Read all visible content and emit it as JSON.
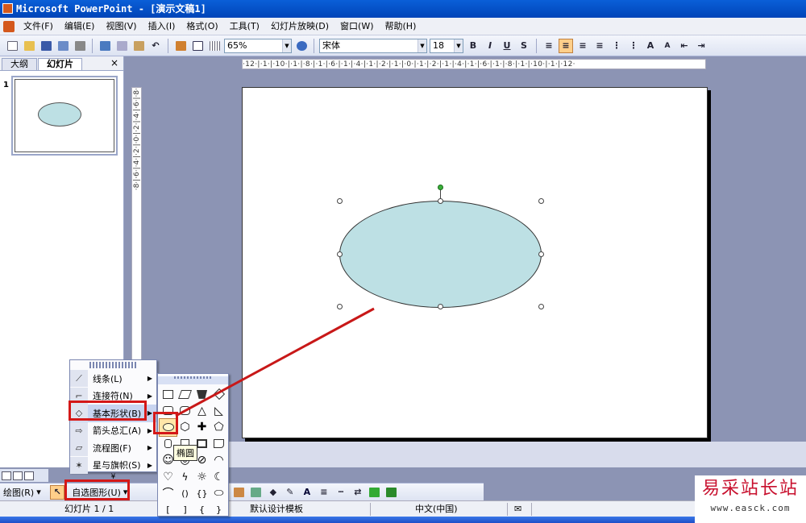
{
  "title": "Microsoft PowerPoint - [演示文稿1]",
  "menu": [
    "文件(F)",
    "编辑(E)",
    "视图(V)",
    "插入(I)",
    "格式(O)",
    "工具(T)",
    "幻灯片放映(D)",
    "窗口(W)",
    "帮助(H)"
  ],
  "toolbar": {
    "zoom": "65%",
    "font": "宋体",
    "size": "18",
    "bold": "B",
    "italic": "I",
    "underline": "U",
    "shadow": "S",
    "font_grow": "A",
    "font_shrink": "A"
  },
  "left_pane": {
    "tabs": [
      "大纲",
      "幻灯片"
    ],
    "close": "×",
    "slide_number": "1"
  },
  "ruler": {
    "horizontal": "·12·|·1·|·10·|·1·|·8·|·1·|·6·|·1·|·4·|·1·|·2·|·1·|·0·|·1·|·2·|·1·|·4·|·1·|·6·|·1·|·8·|·1·|·10·|·1·|·12·",
    "vertical": "·8·|·6·|·4·|·2·|·0·|·2·|·4·|·6·|·8·"
  },
  "autoshape_menu": {
    "items": [
      {
        "label": "线条(L)",
        "icon": "line-icon"
      },
      {
        "label": "连接符(N)",
        "icon": "connector-icon"
      },
      {
        "label": "基本形状(B)",
        "icon": "basic-shapes-icon"
      },
      {
        "label": "箭头总汇(A)",
        "icon": "arrows-icon"
      },
      {
        "label": "流程图(F)",
        "icon": "flowchart-icon"
      },
      {
        "label": "星与旗帜(S)",
        "icon": "stars-icon"
      }
    ],
    "more": "¥"
  },
  "basic_shapes_tooltip": "椭圆",
  "drawbar": {
    "draw": "绘图(R)",
    "autoshape": "自选图形(U)"
  },
  "status": {
    "slide": "幻灯片 1 / 1",
    "template": "默认设计模板",
    "language": "中文(中国)"
  },
  "watermark": {
    "text": "易采站长站",
    "url": "www.easck.com"
  },
  "colors": {
    "ellipse_fill": "#bde0e4",
    "highlight": "#d41818",
    "titlebar": "#0a5fd8"
  }
}
